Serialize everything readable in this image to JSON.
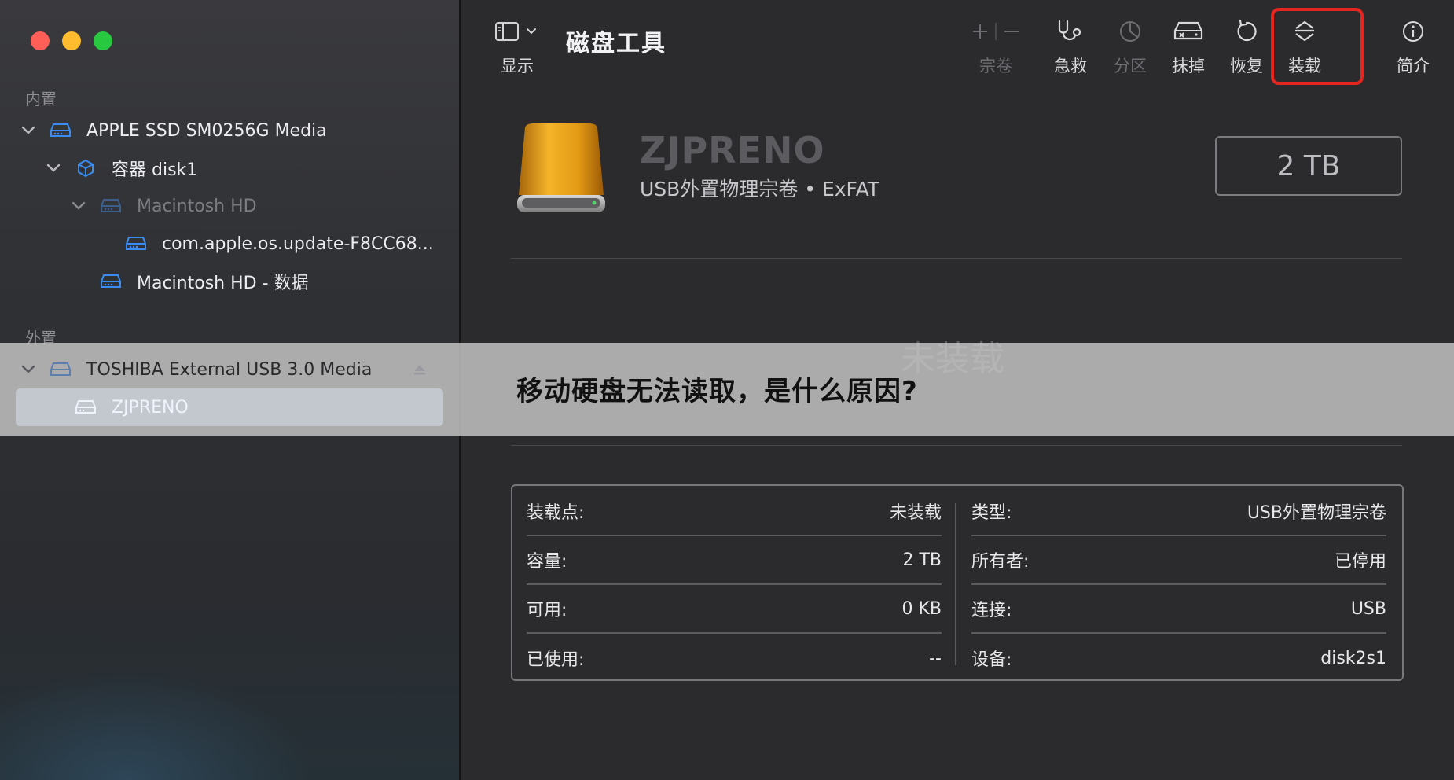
{
  "app": {
    "title": "磁盘工具"
  },
  "toolbar": {
    "view_label": "显示",
    "buttons": [
      {
        "id": "volume",
        "label": "宗卷",
        "icon": "plus-minus-icon",
        "enabled": false
      },
      {
        "id": "first_aid",
        "label": "急救",
        "icon": "stethoscope-icon",
        "enabled": true
      },
      {
        "id": "partition",
        "label": "分区",
        "icon": "pie-chart-icon",
        "enabled": false
      },
      {
        "id": "erase",
        "label": "抹掉",
        "icon": "erase-drive-icon",
        "enabled": true
      },
      {
        "id": "restore",
        "label": "恢复",
        "icon": "restore-arrow-icon",
        "enabled": true
      },
      {
        "id": "mount",
        "label": "装载",
        "icon": "mount-icon",
        "enabled": true,
        "highlighted": true
      },
      {
        "id": "info",
        "label": "简介",
        "icon": "info-icon",
        "enabled": true
      }
    ]
  },
  "sidebar": {
    "internal_label": "内置",
    "external_label": "外置",
    "items": [
      {
        "label": "APPLE SSD SM0256G Media",
        "icon": "internal-drive-icon",
        "expanded": true
      },
      {
        "label": "容器 disk1",
        "icon": "container-cube-icon",
        "expanded": true
      },
      {
        "label": "Macintosh HD",
        "icon": "volume-icon",
        "expanded": true,
        "dimmed": true
      },
      {
        "label": "com.apple.os.update-F8CC68...",
        "icon": "volume-icon"
      },
      {
        "label": "Macintosh HD - 数据",
        "icon": "volume-icon"
      },
      {
        "label": "TOSHIBA External USB 3.0 Media",
        "icon": "external-drive-icon",
        "expanded": true
      },
      {
        "label": "ZJPRENO",
        "icon": "volume-icon",
        "selected": true
      }
    ]
  },
  "volume": {
    "name": "ZJPRENO",
    "subtitle": "USB外置物理宗卷 • ExFAT",
    "size": "2 TB",
    "status_big": "未装载"
  },
  "banner": {
    "text": "移动硬盘无法读取，是什么原因?"
  },
  "info": {
    "left": [
      {
        "key": "装载点:",
        "value": "未装载"
      },
      {
        "key": "容量:",
        "value": "2 TB"
      },
      {
        "key": "可用:",
        "value": "0 KB"
      },
      {
        "key": "已使用:",
        "value": "--"
      }
    ],
    "right": [
      {
        "key": "类型:",
        "value": "USB外置物理宗卷"
      },
      {
        "key": "所有者:",
        "value": "已停用"
      },
      {
        "key": "连接:",
        "value": "USB"
      },
      {
        "key": "设备:",
        "value": "disk2s1"
      }
    ]
  },
  "colors": {
    "accent_blue": "#3b82f6",
    "highlight_red": "#e3261f",
    "selection": "#aec3ea"
  }
}
